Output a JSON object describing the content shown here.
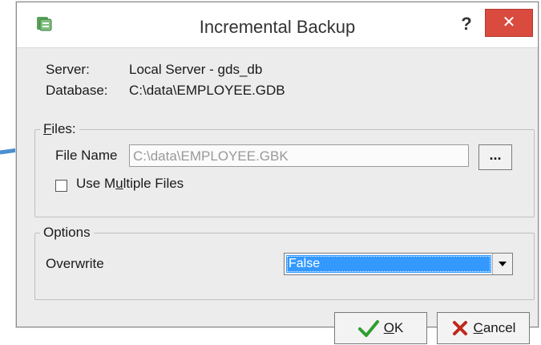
{
  "window": {
    "title": "Incremental Backup",
    "help_symbol": "?",
    "close_symbol": "✕"
  },
  "info": {
    "server_label": "Server:",
    "server_value": "Local Server - gds_db",
    "database_label": "Database:",
    "database_value": "C:\\data\\EMPLOYEE.GDB"
  },
  "files": {
    "legend_first": "F",
    "legend_rest": "iles:",
    "file_name_label": "File Name",
    "file_name_value": "C:\\data\\EMPLOYEE.GBK",
    "browse_label": "...",
    "multiple_label_first": "Use M",
    "multiple_label_u": "u",
    "multiple_label_rest": "ltiple Files",
    "multiple_checked": false
  },
  "options": {
    "legend": "Options",
    "overwrite_label": "Overwrite",
    "overwrite_value": "False"
  },
  "buttons": {
    "ok_u": "O",
    "ok_rest": "K",
    "cancel_u": "C",
    "cancel_rest": "ancel"
  },
  "colors": {
    "close_bg": "#d94b3e",
    "selection": "#3399ff",
    "arrow": "#4a8fcf",
    "ok_check": "#2f9e2f",
    "cancel_x": "#c0281c"
  }
}
